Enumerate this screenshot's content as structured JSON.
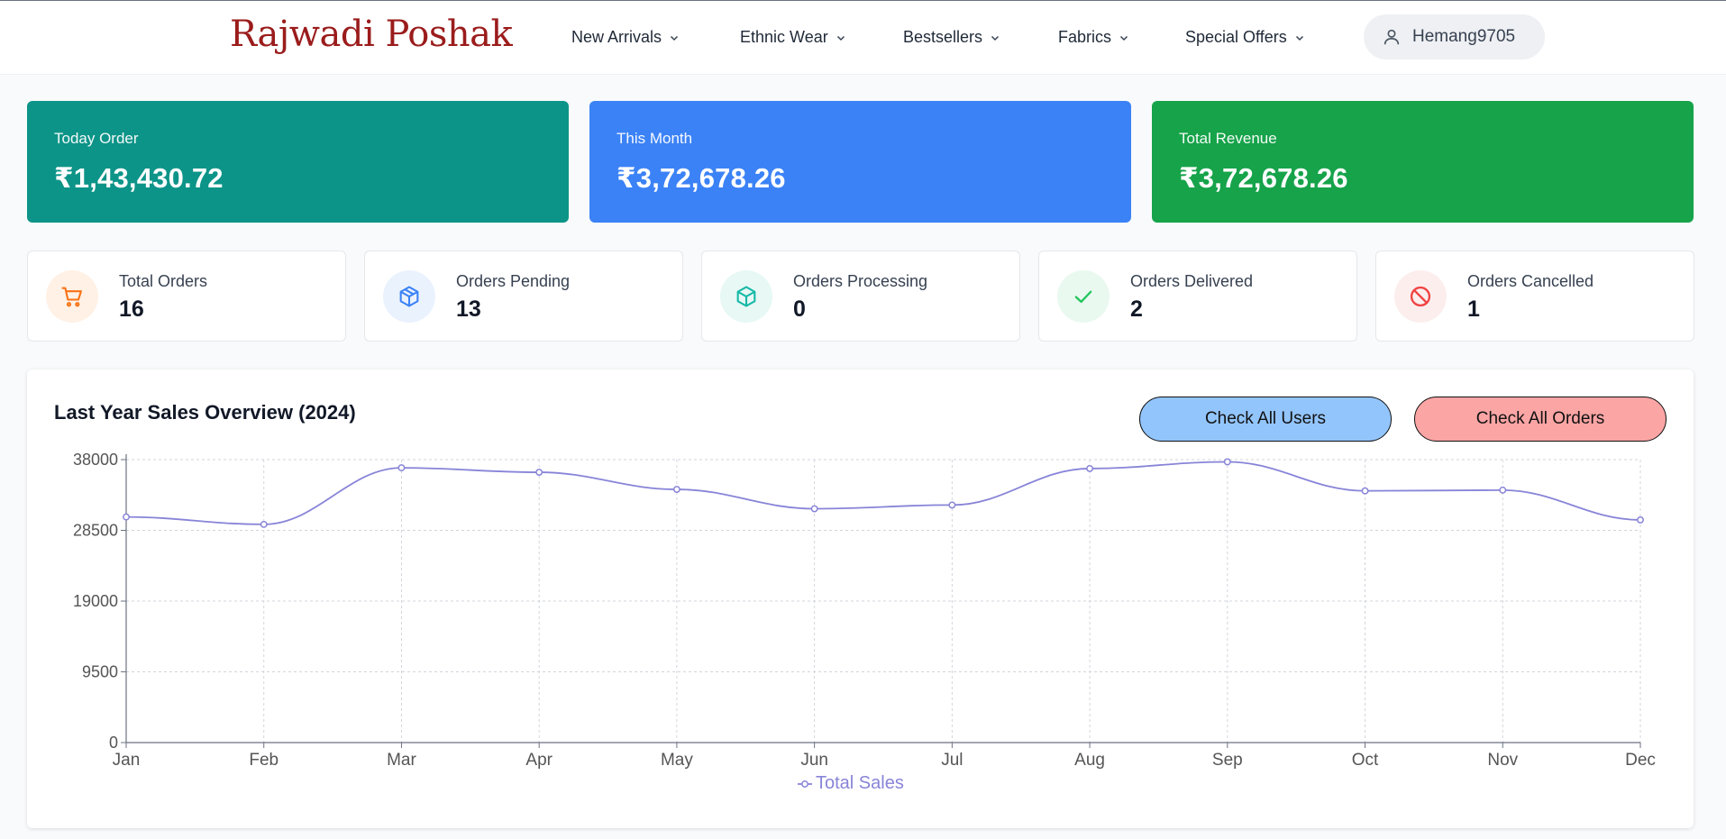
{
  "brand": {
    "name": "Rajwadi Poshak"
  },
  "nav": {
    "items": [
      {
        "label": "New Arrivals"
      },
      {
        "label": "Ethnic Wear"
      },
      {
        "label": "Bestsellers"
      },
      {
        "label": "Fabrics"
      },
      {
        "label": "Special Offers"
      }
    ],
    "user": {
      "name": "Hemang9705",
      "icon": "user-icon"
    }
  },
  "stats": [
    {
      "label": "Today Order",
      "value": "₹1,43,430.72",
      "color": "#0d9488"
    },
    {
      "label": "This Month",
      "value": "₹3,72,678.26",
      "color": "#3b82f6"
    },
    {
      "label": "Total Revenue",
      "value": "₹3,72,678.26",
      "color": "#16a34a"
    }
  ],
  "orders": [
    {
      "label": "Total Orders",
      "value": "16",
      "icon": "cart-icon",
      "color": "#f97316",
      "bg": "#fff1e6"
    },
    {
      "label": "Orders Pending",
      "value": "13",
      "icon": "box-icon",
      "color": "#3b82f6",
      "bg": "#eaf2fe"
    },
    {
      "label": "Orders Processing",
      "value": "0",
      "icon": "box-icon",
      "color": "#14b8a6",
      "bg": "#e7f8f5"
    },
    {
      "label": "Orders Delivered",
      "value": "2",
      "icon": "check-icon",
      "color": "#22c55e",
      "bg": "#e9f9ef"
    },
    {
      "label": "Orders Cancelled",
      "value": "1",
      "icon": "ban-icon",
      "color": "#ef4444",
      "bg": "#fdeeee"
    }
  ],
  "chart_panel": {
    "title": "Last Year Sales Overview (2024)",
    "buttons": [
      {
        "label": "Check All Users",
        "color": "#93c5fd"
      },
      {
        "label": "Check All Orders",
        "color": "#fca5a5"
      }
    ]
  },
  "chart_data": {
    "type": "line",
    "title": "Last Year Sales Overview (2024)",
    "categories": [
      "Jan",
      "Feb",
      "Mar",
      "Apr",
      "May",
      "Jun",
      "Jul",
      "Aug",
      "Sep",
      "Oct",
      "Nov",
      "Dec"
    ],
    "series": [
      {
        "name": "Total Sales",
        "color": "#8884d8",
        "values": [
          30300,
          29300,
          36900,
          36300,
          34000,
          31400,
          31900,
          36800,
          37700,
          33800,
          33900,
          29900
        ]
      }
    ],
    "yticks": [
      "0",
      "9500",
      "19000",
      "28500",
      "38000"
    ],
    "ylim": [
      0,
      38000
    ],
    "grid": true,
    "legend": "bottom-center"
  }
}
